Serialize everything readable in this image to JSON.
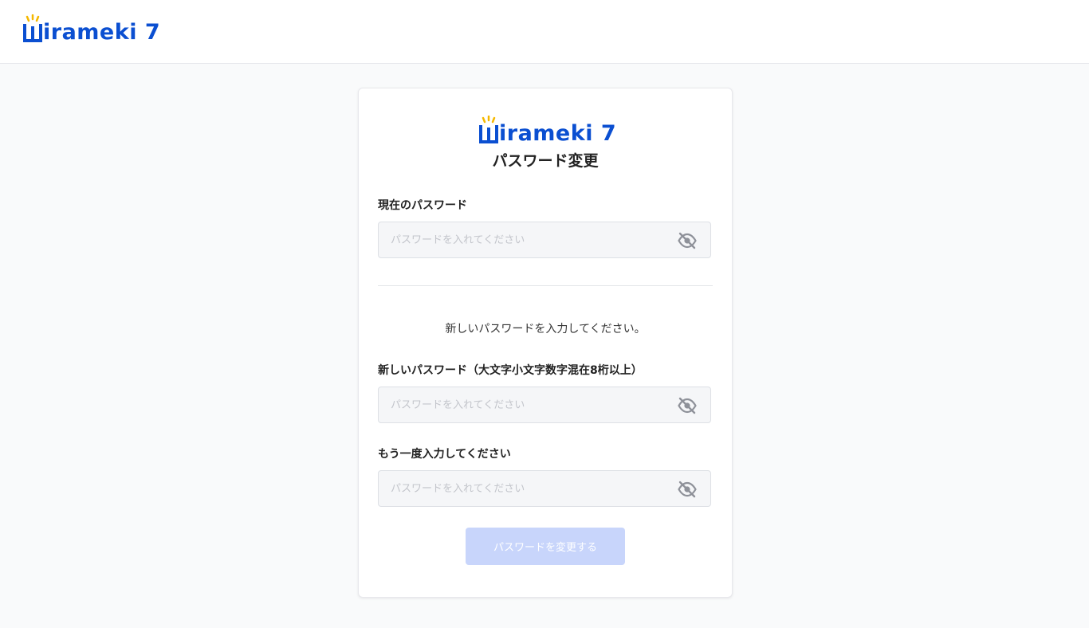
{
  "header": {
    "logo_text": "irameki 7"
  },
  "card": {
    "logo_text": "irameki 7",
    "title": "パスワード変更",
    "current_password": {
      "label": "現在のパスワード",
      "placeholder": "パスワードを入れてください",
      "value": ""
    },
    "info_text": "新しいパスワードを入力してください。",
    "new_password": {
      "label": "新しいパスワード（大文字小文字数字混在8桁以上）",
      "placeholder": "パスワードを入れてください",
      "value": ""
    },
    "confirm_password": {
      "label": "もう一度入力してください",
      "placeholder": "パスワードを入れてください",
      "value": ""
    },
    "submit_label": "パスワードを変更する",
    "visibility_icon": "eye-slash-icon"
  },
  "colors": {
    "brand_blue": "#0b4fd1",
    "logo_accent": "#f5b800",
    "button_disabled": "#c8d5fb",
    "field_bg": "#f5f6f8",
    "page_bg": "#f9fafb"
  }
}
